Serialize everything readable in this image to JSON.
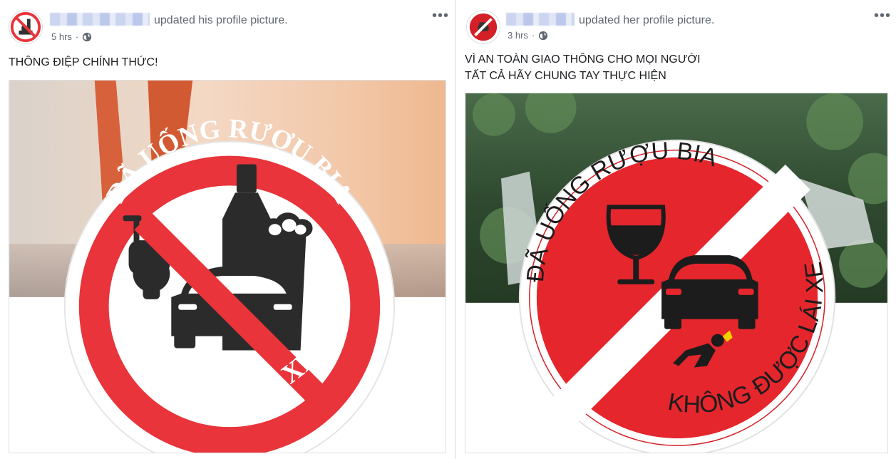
{
  "posts": [
    {
      "action_text": "updated his profile picture.",
      "time": "5 hrs",
      "separator": "·",
      "privacy_icon": "globe-icon",
      "more_label": "•••",
      "text_lines": [
        "THÔNG ĐIỆP CHÍNH THỨC!"
      ],
      "sign": {
        "top_text": "ĐÃ UỐNG RƯỢU BIA",
        "bottom_text": "KHÔNG LÁI XE",
        "icons": [
          "motorbike-icon",
          "car-icon",
          "bottle-icon",
          "beer-glass-icon"
        ]
      }
    },
    {
      "action_text": "updated her profile picture.",
      "time": "3 hrs",
      "separator": "·",
      "privacy_icon": "globe-icon",
      "more_label": "•••",
      "text_lines": [
        "VÌ AN TOÀN GIAO THÔNG CHO MỌI NGƯỜI",
        "TẤT CẢ HÃY CHUNG TAY THỰC HIỆN"
      ],
      "sign": {
        "top_text": "ĐÃ UỐNG RƯỢU BIA",
        "bottom_text": "KHÔNG ĐƯỢC LÁI XE",
        "icons": [
          "wine-glass-icon",
          "car-icon",
          "pedestrian-icon"
        ]
      }
    }
  ],
  "colors": {
    "sign_red": "#e8343a",
    "sign_red_dark": "#d41f26",
    "text_secondary": "#606770"
  }
}
